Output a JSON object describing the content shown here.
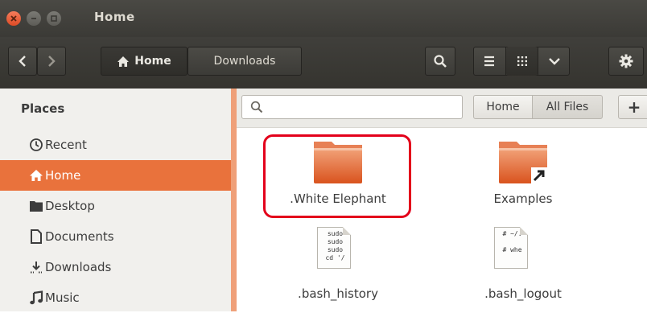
{
  "window": {
    "title": "Home"
  },
  "toolbar": {
    "breadcrumb": [
      {
        "label": "Home",
        "icon": "home-icon"
      },
      {
        "label": "Downloads"
      }
    ]
  },
  "sidebar": {
    "heading": "Places",
    "items": [
      {
        "label": "Recent",
        "icon": "clock-icon",
        "active": false
      },
      {
        "label": "Home",
        "icon": "home-icon",
        "active": true
      },
      {
        "label": "Desktop",
        "icon": "folder-icon",
        "active": false
      },
      {
        "label": "Documents",
        "icon": "document-icon",
        "active": false
      },
      {
        "label": "Downloads",
        "icon": "download-icon",
        "active": false
      },
      {
        "label": "Music",
        "icon": "music-icon",
        "active": false
      }
    ]
  },
  "search": {
    "scope": {
      "home_label": "Home",
      "all_files_label": "All Files"
    },
    "add_label": "+"
  },
  "files": [
    {
      "name": ".White Elephant",
      "type": "folder",
      "highlighted": true
    },
    {
      "name": "Examples",
      "type": "folder-link"
    },
    {
      "name": ".bash_history",
      "type": "text",
      "preview": [
        "sudo",
        "sudo",
        "sudo",
        "cd '/"
      ]
    },
    {
      "name": ".bash_logout",
      "type": "text",
      "preview": [
        "# ~/.",
        "",
        "# whe"
      ]
    }
  ],
  "colors": {
    "accent": "#e9723c",
    "highlight": "#e3001b",
    "titlebar": "#3c3b37"
  }
}
